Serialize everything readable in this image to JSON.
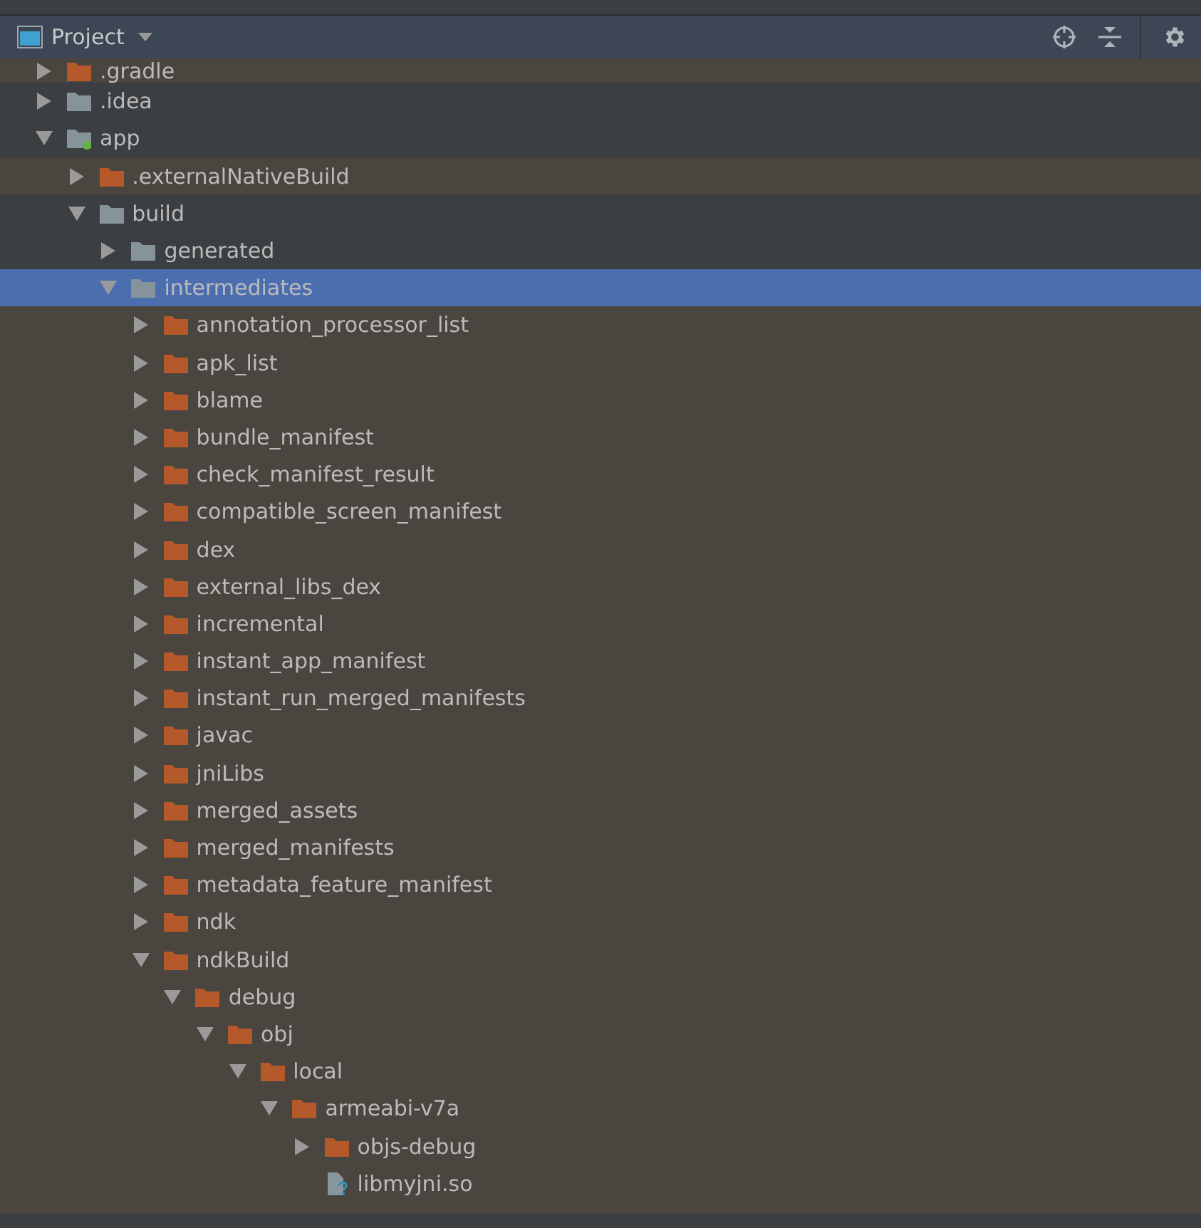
{
  "panel": {
    "title": "Project"
  },
  "tree": [
    {
      "name": ".gradle",
      "kind": "folder",
      "excluded": true,
      "expanded": false,
      "selected": false
    },
    {
      "name": ".idea",
      "kind": "folder",
      "excluded": false,
      "expanded": false,
      "selected": false
    },
    {
      "name": "app",
      "kind": "module",
      "excluded": false,
      "expanded": true,
      "selected": false,
      "children": [
        {
          "name": ".externalNativeBuild",
          "kind": "folder",
          "excluded": true,
          "expanded": false,
          "selected": false
        },
        {
          "name": "build",
          "kind": "folder",
          "excluded": false,
          "expanded": true,
          "selected": false,
          "children": [
            {
              "name": "generated",
              "kind": "folder",
              "excluded": false,
              "expanded": false,
              "selected": false
            },
            {
              "name": "intermediates",
              "kind": "folder",
              "excluded": false,
              "expanded": true,
              "selected": true,
              "children": [
                {
                  "name": "annotation_processor_list",
                  "kind": "folder",
                  "excluded": true,
                  "expanded": false,
                  "selected": false
                },
                {
                  "name": "apk_list",
                  "kind": "folder",
                  "excluded": true,
                  "expanded": false,
                  "selected": false
                },
                {
                  "name": "blame",
                  "kind": "folder",
                  "excluded": true,
                  "expanded": false,
                  "selected": false
                },
                {
                  "name": "bundle_manifest",
                  "kind": "folder",
                  "excluded": true,
                  "expanded": false,
                  "selected": false
                },
                {
                  "name": "check_manifest_result",
                  "kind": "folder",
                  "excluded": true,
                  "expanded": false,
                  "selected": false
                },
                {
                  "name": "compatible_screen_manifest",
                  "kind": "folder",
                  "excluded": true,
                  "expanded": false,
                  "selected": false
                },
                {
                  "name": "dex",
                  "kind": "folder",
                  "excluded": true,
                  "expanded": false,
                  "selected": false
                },
                {
                  "name": "external_libs_dex",
                  "kind": "folder",
                  "excluded": true,
                  "expanded": false,
                  "selected": false
                },
                {
                  "name": "incremental",
                  "kind": "folder",
                  "excluded": true,
                  "expanded": false,
                  "selected": false
                },
                {
                  "name": "instant_app_manifest",
                  "kind": "folder",
                  "excluded": true,
                  "expanded": false,
                  "selected": false
                },
                {
                  "name": "instant_run_merged_manifests",
                  "kind": "folder",
                  "excluded": true,
                  "expanded": false,
                  "selected": false
                },
                {
                  "name": "javac",
                  "kind": "folder",
                  "excluded": true,
                  "expanded": false,
                  "selected": false
                },
                {
                  "name": "jniLibs",
                  "kind": "folder",
                  "excluded": true,
                  "expanded": false,
                  "selected": false
                },
                {
                  "name": "merged_assets",
                  "kind": "folder",
                  "excluded": true,
                  "expanded": false,
                  "selected": false
                },
                {
                  "name": "merged_manifests",
                  "kind": "folder",
                  "excluded": true,
                  "expanded": false,
                  "selected": false
                },
                {
                  "name": "metadata_feature_manifest",
                  "kind": "folder",
                  "excluded": true,
                  "expanded": false,
                  "selected": false
                },
                {
                  "name": "ndk",
                  "kind": "folder",
                  "excluded": true,
                  "expanded": false,
                  "selected": false
                },
                {
                  "name": "ndkBuild",
                  "kind": "folder",
                  "excluded": true,
                  "expanded": true,
                  "selected": false,
                  "children": [
                    {
                      "name": "debug",
                      "kind": "folder",
                      "excluded": true,
                      "expanded": true,
                      "selected": false,
                      "children": [
                        {
                          "name": "obj",
                          "kind": "folder",
                          "excluded": true,
                          "expanded": true,
                          "selected": false,
                          "children": [
                            {
                              "name": "local",
                              "kind": "folder",
                              "excluded": true,
                              "expanded": true,
                              "selected": false,
                              "children": [
                                {
                                  "name": "armeabi-v7a",
                                  "kind": "folder",
                                  "excluded": true,
                                  "expanded": true,
                                  "selected": false,
                                  "children": [
                                    {
                                      "name": "objs-debug",
                                      "kind": "folder",
                                      "excluded": true,
                                      "expanded": false,
                                      "selected": false
                                    },
                                    {
                                      "name": "libmyjni.so",
                                      "kind": "file",
                                      "excluded": true,
                                      "selected": false
                                    }
                                  ]
                                }
                              ]
                            }
                          ]
                        }
                      ]
                    }
                  ]
                }
              ]
            }
          ]
        }
      ]
    }
  ]
}
